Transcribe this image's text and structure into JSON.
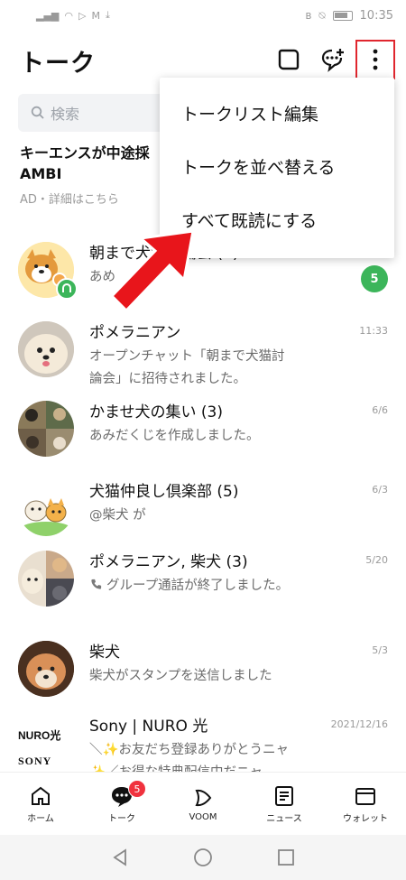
{
  "statusbar": {
    "time": "10:35"
  },
  "header": {
    "title": "トーク"
  },
  "search": {
    "placeholder": "検索"
  },
  "ad": {
    "title_line1": "キーエンスが中途採",
    "title_line2": "AMBI",
    "subtitle": "AD・詳細はこちら"
  },
  "menu": {
    "items": [
      {
        "label": "トークリスト編集"
      },
      {
        "label": "トークを並べ替える"
      },
      {
        "label": "すべて既読にする"
      }
    ]
  },
  "chats": [
    {
      "name": "朝まで犬猫討論会 (4)",
      "preview": "あめ",
      "time": "",
      "unread": "5",
      "avatar_icon": "shiba-cat-illustration"
    },
    {
      "name": "ポメラニアン",
      "preview": "オープンチャット「朝まで犬猫討論会」に招待されました。",
      "time": "11:33",
      "avatar_icon": "pomeranian-photo"
    },
    {
      "name": "かませ犬の集い (3)",
      "preview": "あみだくじを作成しました。",
      "time": "6/6",
      "avatar_icon": "dogs-collage-photo"
    },
    {
      "name": "犬猫仲良し倶楽部 (5)",
      "preview": "@柴犬 が",
      "time": "6/3",
      "avatar_icon": "dog-cat-illustration"
    },
    {
      "name": "ポメラニアン, 柴犬 (3)",
      "preview": "グループ通話が終了しました。",
      "time": "5/20",
      "avatar_icon": "group-photo"
    },
    {
      "name": "柴犬",
      "preview": "柴犬がスタンプを送信しました",
      "time": "5/3",
      "avatar_icon": "shiba-photo"
    },
    {
      "name": "Sony | NURO 光",
      "preview": "＼✨お友だち登録ありがとうニャ✨／お得な特典配信中だニャ…",
      "time": "2021/12/16",
      "avatar_icon": "nuro-sony-logo",
      "logo_top": "NURO光",
      "logo_bottom": "SONY"
    }
  ],
  "tabs": [
    {
      "label": "ホーム",
      "icon": "home-icon"
    },
    {
      "label": "トーク",
      "icon": "talk-icon",
      "badge": "5"
    },
    {
      "label": "VOOM",
      "icon": "voom-icon"
    },
    {
      "label": "ニュース",
      "icon": "news-icon"
    },
    {
      "label": "ウォレット",
      "icon": "wallet-icon"
    }
  ],
  "colors": {
    "accent_green": "#3cb55a",
    "badge_red": "#f0323e",
    "highlight_red": "#e0262e",
    "arrow_red": "#e8151b"
  }
}
